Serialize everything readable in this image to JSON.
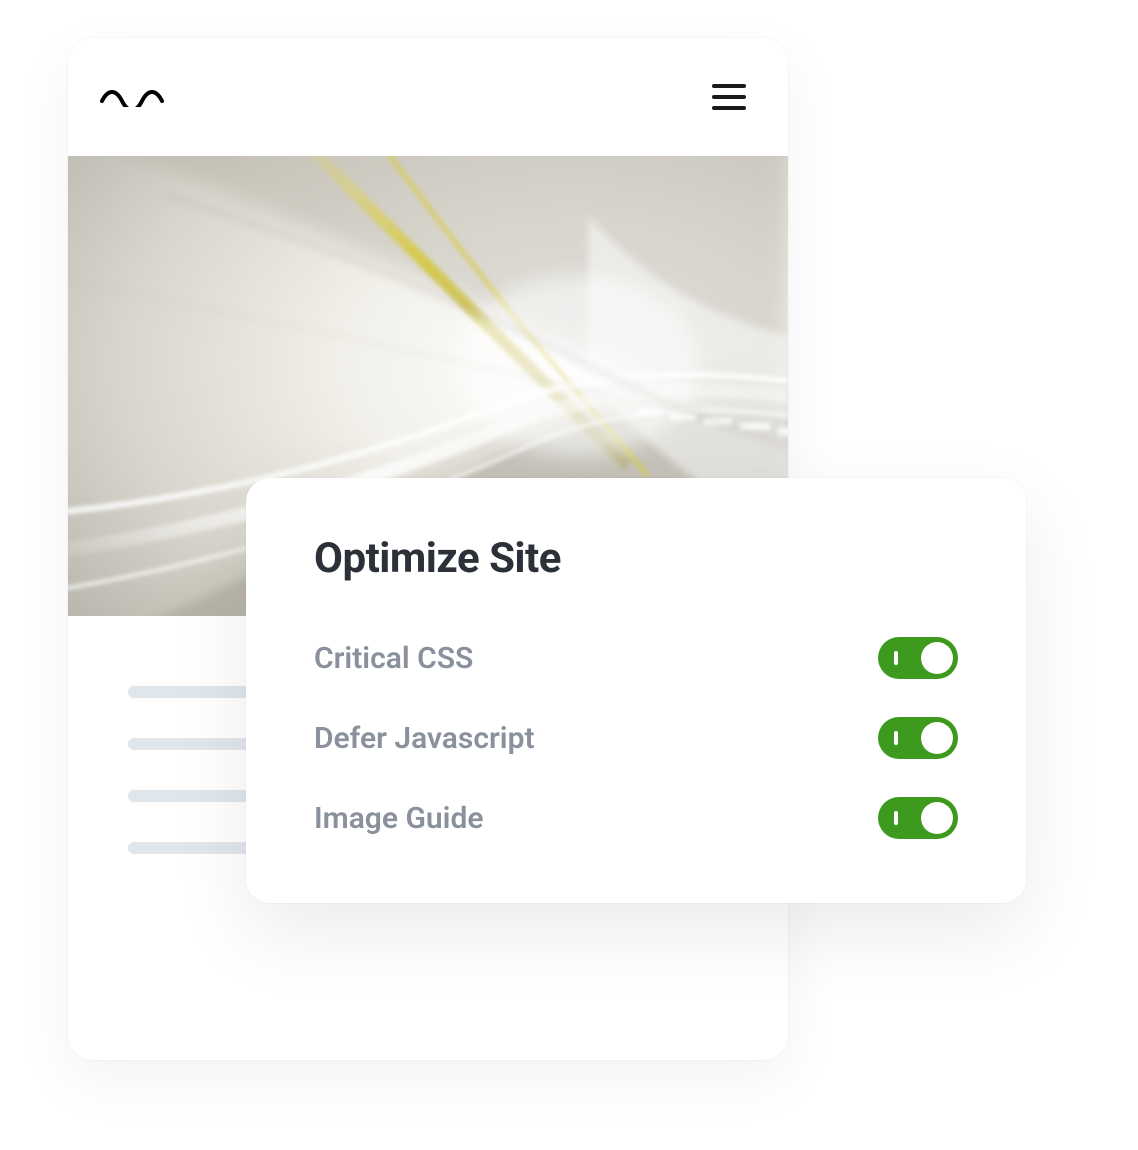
{
  "panel": {
    "title": "Optimize Site",
    "settings": [
      {
        "label": "Critical CSS",
        "enabled": true
      },
      {
        "label": "Defer Javascript",
        "enabled": true
      },
      {
        "label": "Image Guide",
        "enabled": true
      }
    ]
  },
  "colors": {
    "toggle_on": "#3d9a1f",
    "text_muted": "#8a919c",
    "text_heading": "#2c3038",
    "placeholder": "#dfe6ec"
  },
  "icons": {
    "logo": "wave-logo",
    "menu": "hamburger-icon"
  }
}
